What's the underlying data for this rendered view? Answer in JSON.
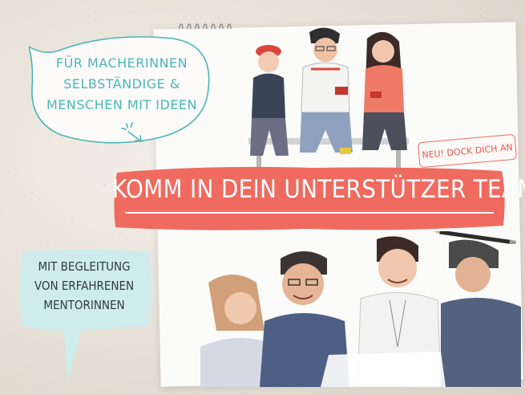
{
  "bubble_top": {
    "lines": [
      "FÜR MACHERINNEN",
      "SELBSTÄNDIGE &",
      "MENSCHEN MIT IDEEN"
    ]
  },
  "tag": {
    "label": "NEU! DOCK DICH AN"
  },
  "banner": {
    "headline": "KOMM IN DEIN UNTERSTÜTZER TEAM"
  },
  "bubble_bottom": {
    "lines": [
      "MIT BEGLEITUNG",
      "VON ERFAHRENEN",
      "MENTORINNEN"
    ]
  },
  "colors": {
    "teal": "#4bb6b5",
    "coral": "#ef6a5f",
    "mint_box": "#cdeceb",
    "ink": "#2f3b3c"
  },
  "icons": [
    "spiral-binding-icon",
    "pencil-icon",
    "sparkle-arrow-icon"
  ]
}
